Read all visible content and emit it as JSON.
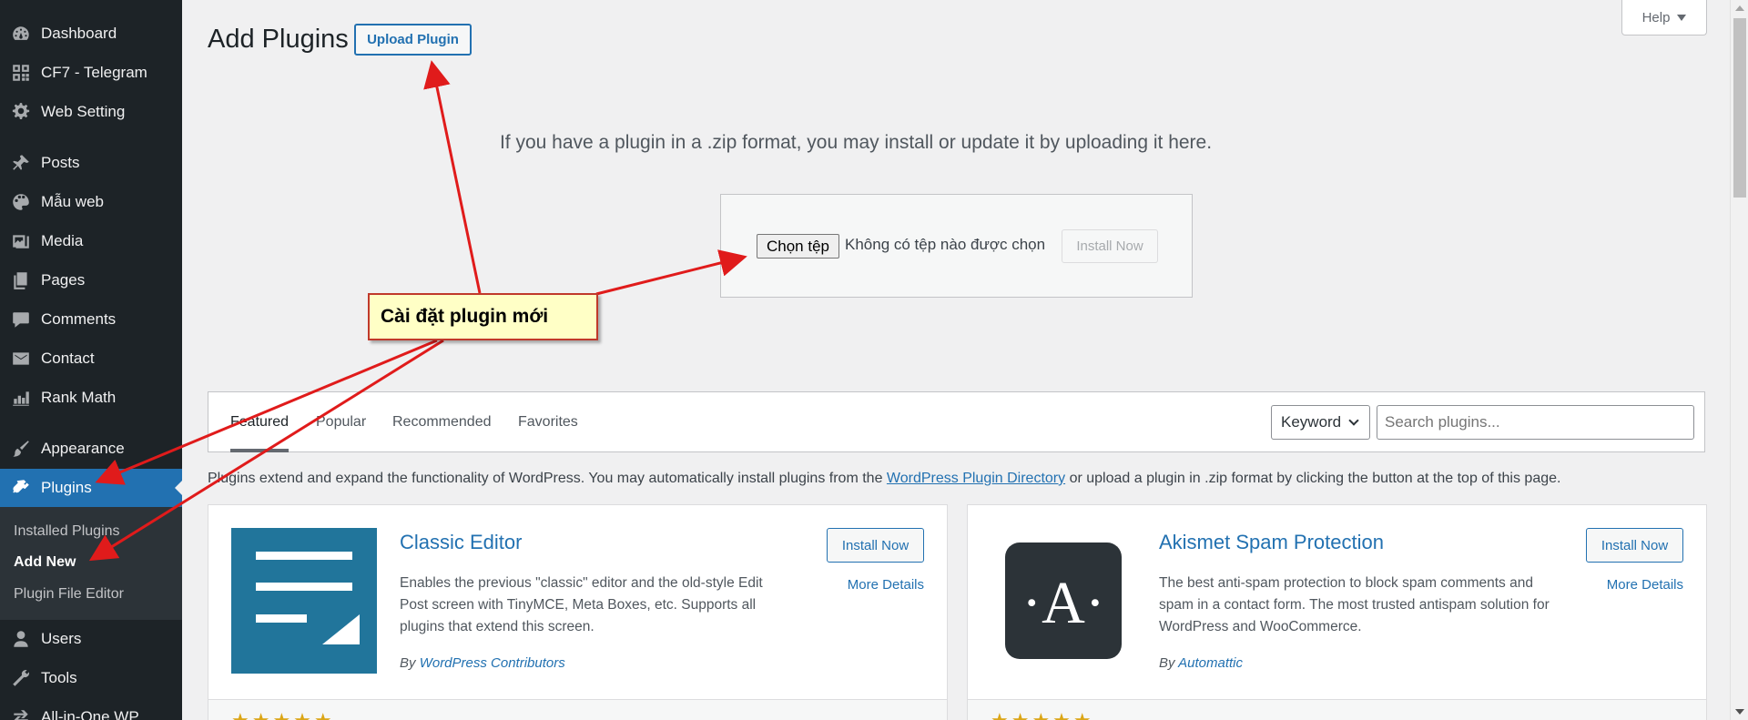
{
  "sidebar": {
    "items": [
      {
        "label": "Dashboard",
        "icon": "dashboard-icon"
      },
      {
        "label": "CF7 - Telegram",
        "icon": "qr-grid-icon"
      },
      {
        "label": "Web Setting",
        "icon": "gear-icon"
      },
      {
        "label": "Posts",
        "icon": "pushpin-icon"
      },
      {
        "label": "Mẫu web",
        "icon": "palette-icon"
      },
      {
        "label": "Media",
        "icon": "media-icon"
      },
      {
        "label": "Pages",
        "icon": "pages-icon"
      },
      {
        "label": "Comments",
        "icon": "comment-icon"
      },
      {
        "label": "Contact",
        "icon": "envelope-icon"
      },
      {
        "label": "Rank Math",
        "icon": "chart-icon"
      },
      {
        "label": "Appearance",
        "icon": "brush-icon"
      },
      {
        "label": "Plugins",
        "icon": "plugin-icon"
      },
      {
        "label": "Users",
        "icon": "user-icon"
      },
      {
        "label": "Tools",
        "icon": "wrench-icon"
      },
      {
        "label": "All-in-One WP",
        "icon": "migration-icon"
      }
    ],
    "submenu": [
      "Installed Plugins",
      "Add New",
      "Plugin File Editor"
    ]
  },
  "header": {
    "title": "Add Plugins",
    "upload_button": "Upload Plugin",
    "help": "Help"
  },
  "upload": {
    "description": "If you have a plugin in a .zip format, you may install or update it by uploading it here.",
    "choose_file": "Chọn tệp",
    "no_file": "Không có tệp nào được chọn",
    "install_now": "Install Now"
  },
  "annotation": {
    "callout": "Cài đặt plugin mới"
  },
  "filters": {
    "tabs": [
      "Featured",
      "Popular",
      "Recommended",
      "Favorites"
    ],
    "keyword": "Keyword",
    "search_placeholder": "Search plugins..."
  },
  "intro": {
    "before": "Plugins extend and expand the functionality of WordPress. You may automatically install plugins from the ",
    "link": "WordPress Plugin Directory",
    "after": " or upload a plugin in .zip format by clicking the button at the top of this page."
  },
  "plugins": [
    {
      "name": "Classic Editor",
      "description": "Enables the previous \"classic\" editor and the old-style Edit Post screen with TinyMCE, Meta Boxes, etc. Supports all plugins that extend this screen.",
      "by": "By",
      "author": "WordPress Contributors",
      "install": "Install Now",
      "more": "More Details",
      "icon": "classic-editor-icon",
      "rating": 5
    },
    {
      "name": "Akismet Spam Protection",
      "description": "The best anti-spam protection to block spam comments and spam in a contact form. The most trusted antispam solution for WordPress and WooCommerce.",
      "by": "By",
      "author": "Automattic",
      "install": "Install Now",
      "more": "More Details",
      "icon": "akismet-icon",
      "icon_letter": "·A·",
      "rating": 5
    }
  ],
  "colors": {
    "sidebar_bg": "#1d2327",
    "accent": "#2271b1",
    "annotation_red": "#e01b1b",
    "callout_bg": "#ffffc6"
  }
}
